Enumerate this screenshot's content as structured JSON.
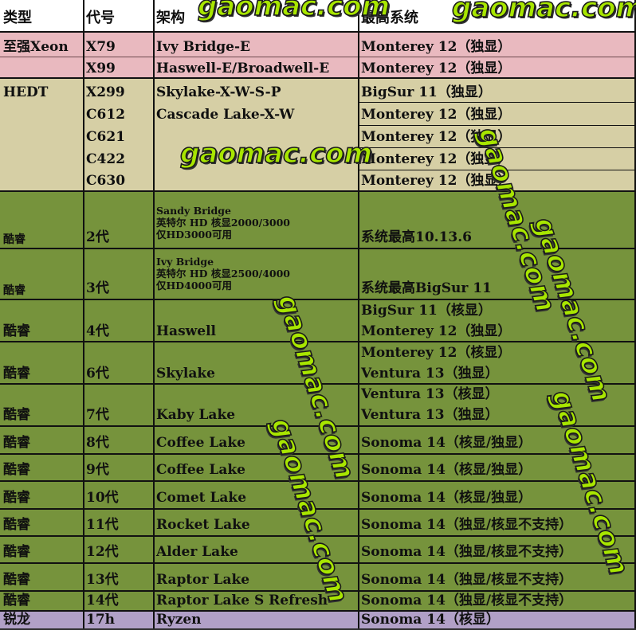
{
  "header": {
    "type": "类型",
    "code": "代号",
    "arch": "架构",
    "max_os": "最高系统"
  },
  "rows": [
    {
      "type": "至强Xeon",
      "code": "X79",
      "arch": "Ivy Bridge-E",
      "os": [
        "Monterey 12（独显）"
      ]
    },
    {
      "type": "",
      "code": "X99",
      "arch": "Haswell-E/Broadwell-E",
      "os": [
        "Monterey 12（独显）"
      ]
    },
    {
      "type": "HEDT",
      "code": "X299",
      "arch": "Skylake-X-W-S-P",
      "os": [
        "BigSur 11（独显）"
      ]
    },
    {
      "type": "",
      "code": "C612",
      "arch": "Cascade Lake-X-W",
      "os": [
        "Monterey 12（独显）"
      ]
    },
    {
      "type": "",
      "code": "C621",
      "arch": "",
      "os": [
        "Monterey 12（独显）"
      ]
    },
    {
      "type": "",
      "code": "C422",
      "arch": "",
      "os": [
        "Monterey 12（独显）"
      ]
    },
    {
      "type": "",
      "code": "C630",
      "arch": "",
      "os": [
        "Monterey 12（独显）"
      ]
    },
    {
      "type": "酷睿",
      "code": "2代",
      "arch_lines": [
        "Sandy Bridge",
        "英特尔 HD 核显2000/3000",
        "仅HD3000可用"
      ],
      "os": [
        "系统最高10.13.6"
      ]
    },
    {
      "type": "酷睿",
      "code": "3代",
      "arch_lines": [
        "Ivy Bridge",
        "英特尔 HD 核显2500/4000",
        "仅HD4000可用"
      ],
      "os": [
        "系统最高BigSur 11"
      ]
    },
    {
      "type": "酷睿",
      "code": "4代",
      "arch": "Haswell",
      "os": [
        "BigSur 11（核显）",
        "Monterey 12（独显）"
      ]
    },
    {
      "type": "酷睿",
      "code": "6代",
      "arch": "Skylake",
      "os": [
        "Monterey 12（核显）",
        "Ventura 13（独显）"
      ]
    },
    {
      "type": "酷睿",
      "code": "7代",
      "arch": "Kaby Lake",
      "os": [
        "Ventura 13（核显）",
        "Ventura 13（独显）"
      ]
    },
    {
      "type": "酷睿",
      "code": "8代",
      "arch": "Coffee Lake",
      "os": [
        "Sonoma 14（核显/独显）"
      ]
    },
    {
      "type": "酷睿",
      "code": "9代",
      "arch": "Coffee Lake",
      "os": [
        "Sonoma 14（核显/独显）"
      ]
    },
    {
      "type": "酷睿",
      "code": "10代",
      "arch": "Comet Lake",
      "os": [
        "Sonoma 14（核显/独显）"
      ]
    },
    {
      "type": "酷睿",
      "code": "11代",
      "arch": "Rocket Lake",
      "os": [
        "Sonoma 14（独显/核显不支持）"
      ]
    },
    {
      "type": "酷睿",
      "code": "12代",
      "arch": "Alder Lake",
      "os": [
        "Sonoma 14（独显/核显不支持）"
      ]
    },
    {
      "type": "酷睿",
      "code": "13代",
      "arch": "Raptor Lake",
      "os": [
        "Sonoma 14（独显/核显不支持）"
      ]
    },
    {
      "type": "酷睿",
      "code": "14代",
      "arch": "Raptor Lake S Refresh",
      "os": [
        "Sonoma 14（独显/核显不支持）"
      ]
    },
    {
      "type": "锐龙",
      "code": "17h",
      "arch": "Ryzen",
      "os": [
        "Sonoma 14（核显）"
      ]
    }
  ],
  "watermark": "gaomac.com",
  "colors": {
    "header_bg": "#ffffff",
    "xeon_bg": "#e9b9bf",
    "hedt_bg": "#d6cfa5",
    "core_bg": "#76933c",
    "ryzen_bg": "#b1a0c7",
    "watermark": "#a8e600"
  }
}
